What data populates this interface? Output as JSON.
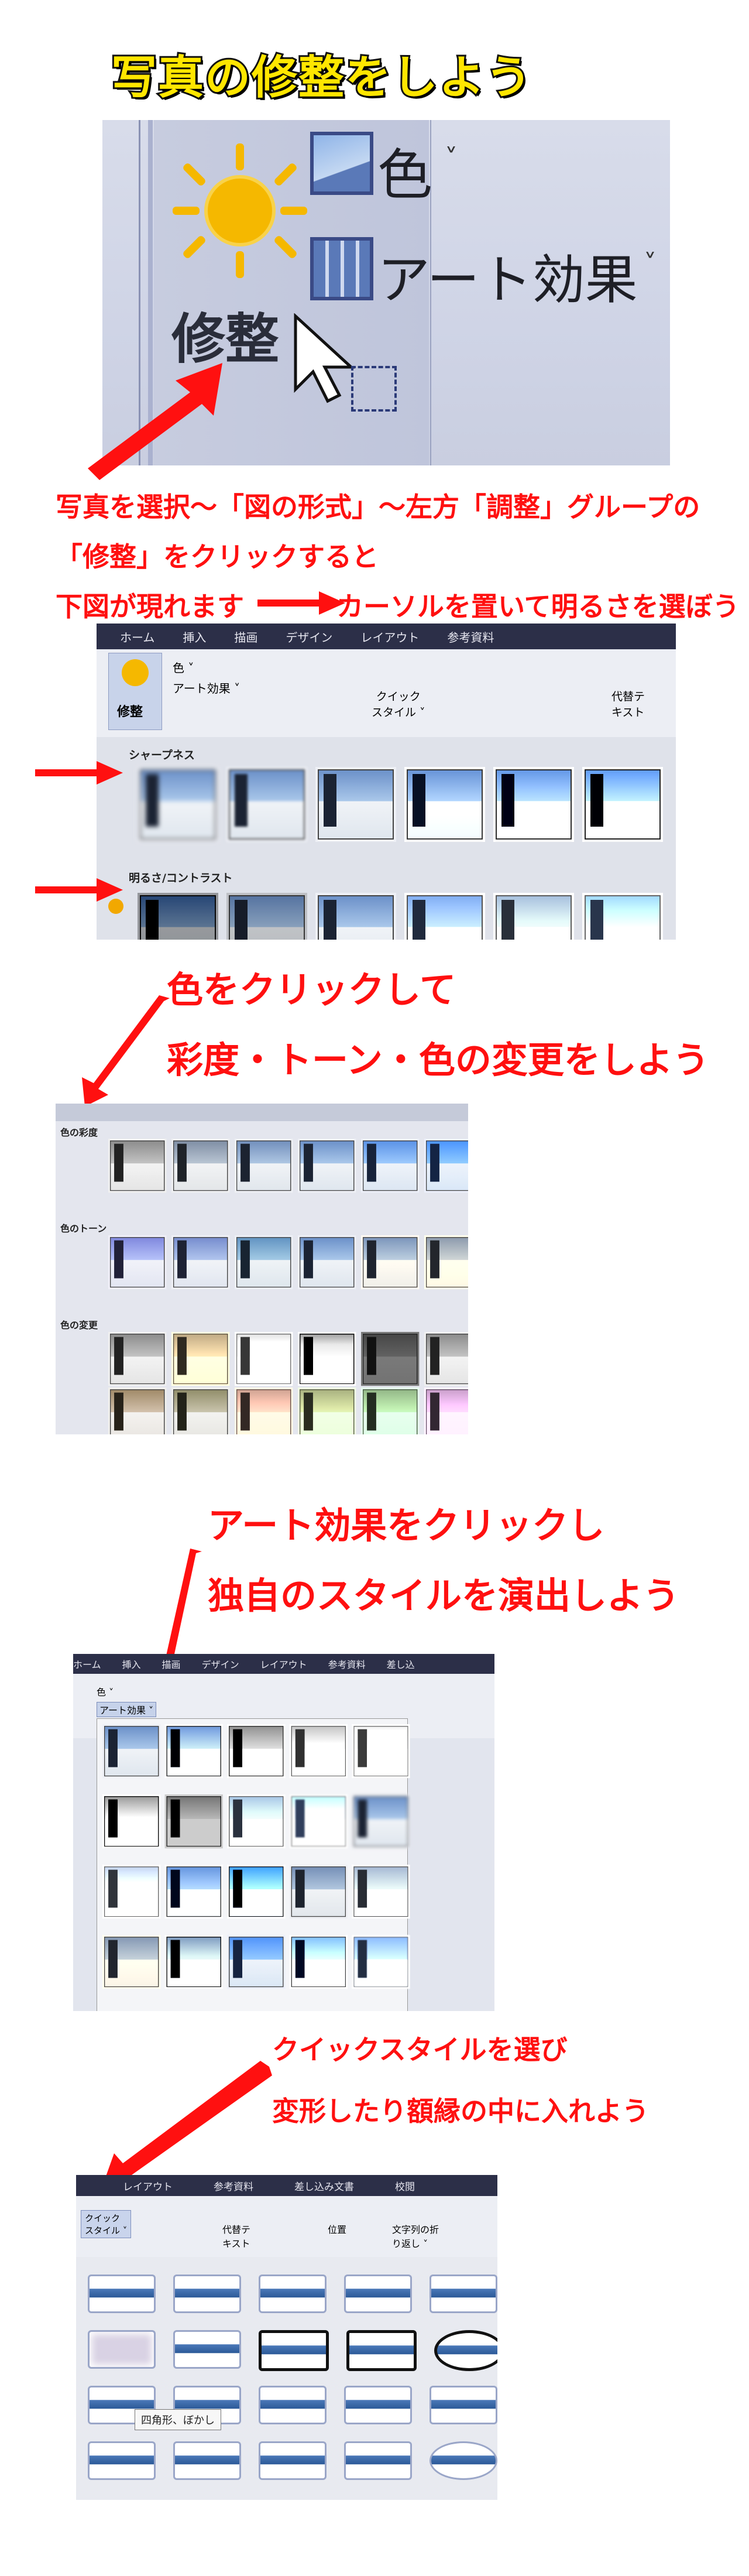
{
  "title": "写真の修整をしよう",
  "zoom": {
    "correct_label": "修整",
    "color_label": "色",
    "art_label": "アート効果"
  },
  "captions": {
    "step1_line1": "写真を選択～「図の形式」～左方「調整」グループの",
    "step1_line2": "「修整」をクリックすると",
    "step1_line3a": "下図が現れます",
    "step1_line3b": "カーソルを置いて明るさを選ぼう",
    "step2_line1": "色をクリックして",
    "step2_line2": "彩度・トーン・色の変更をしよう",
    "step3_line1": "アート効果をクリックし",
    "step3_line2": "独自のスタイルを演出しよう",
    "step4_line1": "クイックスタイルを選び",
    "step4_line2": "変形したり額縁の中に入れよう"
  },
  "shot1": {
    "tabs": [
      "ホーム",
      "挿入",
      "描画",
      "デザイン",
      "レイアウト",
      "参考資料"
    ],
    "correct": "修整",
    "color": "色 ˅",
    "art": "アート効果 ˅",
    "quick_style": "クイック\nスタイル ˅",
    "alt_text": "代替テ\nキスト",
    "sharpness": "シャープネス",
    "brightness": "明るさ/コントラスト"
  },
  "shot2": {
    "saturation": "色の彩度",
    "tone": "色のトーン",
    "recolor": "色の変更"
  },
  "shot3": {
    "tabs": [
      "ホーム",
      "挿入",
      "描画",
      "デザイン",
      "レイアウト",
      "参考資料",
      "差し込"
    ],
    "color": "色 ˅",
    "art": "アート効果 ˅"
  },
  "shot4": {
    "tabs": [
      "レイアウト",
      "参考資料",
      "差し込み文書",
      "校閲"
    ],
    "quick_style": "クイック\nスタイル ˅",
    "alt_text": "代替テ\nキスト",
    "position": "位置",
    "wrap": "文字列の折\nり返し ˅",
    "tooltip": "四角形、ぼかし"
  },
  "colors": {
    "accent": "#ff1010",
    "title_fill": "#ffe600"
  },
  "icons": [
    "sun-icon",
    "picture-icon",
    "art-effects-icon",
    "cursor-icon",
    "red-arrow-icon"
  ]
}
